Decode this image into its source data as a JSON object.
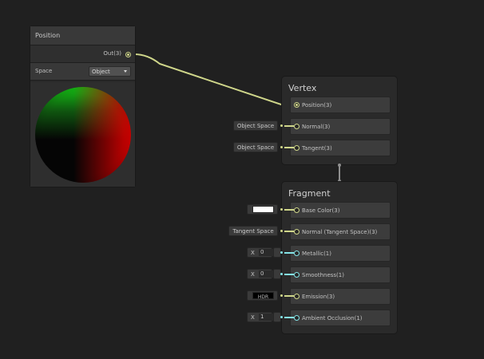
{
  "position_node": {
    "title": "Position",
    "output_label": "Out(3)",
    "space_label": "Space",
    "space_value": "Object"
  },
  "vertex": {
    "title": "Vertex",
    "blocks": [
      {
        "label": "Position(3)"
      },
      {
        "label": "Normal(3)",
        "default": "Object Space"
      },
      {
        "label": "Tangent(3)",
        "default": "Object Space"
      }
    ]
  },
  "fragment": {
    "title": "Fragment",
    "blocks": [
      {
        "label": "Base Color(3)"
      },
      {
        "label": "Normal (Tangent Space)(3)",
        "default": "Tangent Space"
      },
      {
        "label": "Metallic(1)",
        "x_label": "X",
        "x_value": "0"
      },
      {
        "label": "Smoothness(1)",
        "x_label": "X",
        "x_value": "0"
      },
      {
        "label": "Emission(3)",
        "hdr_label": "HDR"
      },
      {
        "label": "Ambient Occlusion(1)",
        "x_label": "X",
        "x_value": "1"
      }
    ]
  },
  "colors": {
    "vector3_port": "#cfd68a",
    "vector1_port": "#84e4e7",
    "base_color_swatch": "#ffffff",
    "emission_swatch": "#000000"
  }
}
